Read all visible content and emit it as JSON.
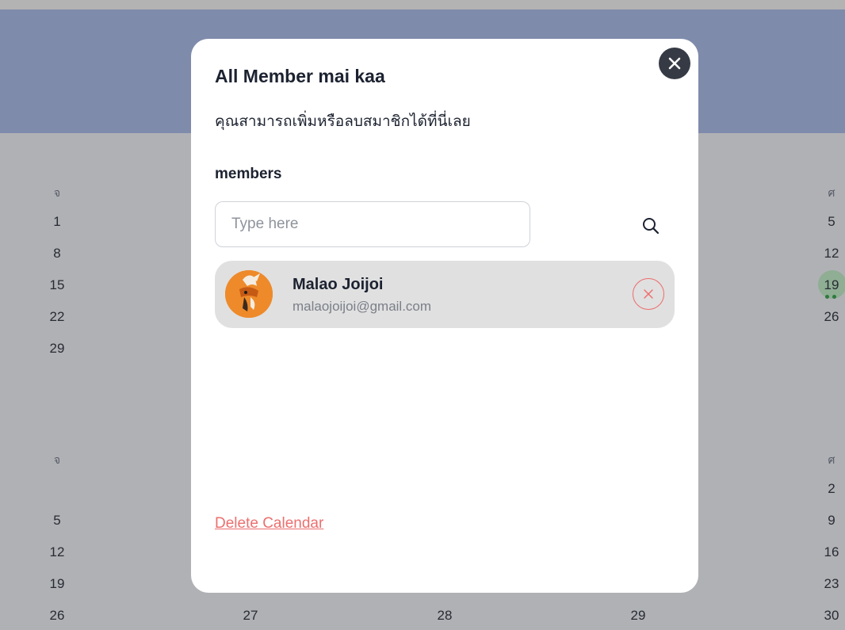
{
  "background": {
    "calendar_top": {
      "left_header": "จ",
      "right_header": "ศ",
      "left_days": [
        "1",
        "8",
        "15",
        "22",
        "29"
      ],
      "right_days": [
        "5",
        "12",
        "19",
        "26"
      ],
      "today": "19"
    },
    "calendar_bottom": {
      "left_header": "จ",
      "right_header": "ศ",
      "left_days": [
        "5",
        "12",
        "19",
        "26"
      ],
      "right_days": [
        "2",
        "9",
        "16",
        "23",
        "30"
      ],
      "last_row_middle": [
        "27",
        "28",
        "29"
      ]
    },
    "colors": {
      "banner": "#7f8bab",
      "today_highlight": "#8fae94"
    }
  },
  "modal": {
    "title": "All Member mai kaa",
    "subtitle": "คุณสามารถเพิ่มหรือลบสมาชิกได้ที่นี่เลย",
    "section_label": "members",
    "search": {
      "placeholder": "Type here",
      "value": "",
      "icon": "search-icon"
    },
    "close_icon": "close-icon",
    "members": [
      {
        "name": "Malao Joijoi",
        "email": "malaojoijoi@gmail.com",
        "avatar_color": "#ee8a2a",
        "remove_icon": "remove-icon"
      }
    ],
    "delete_label": "Delete Calendar",
    "colors": {
      "danger": "#ec6f6f",
      "close_bg": "#353a45",
      "card_bg": "#e0e0e0"
    }
  }
}
